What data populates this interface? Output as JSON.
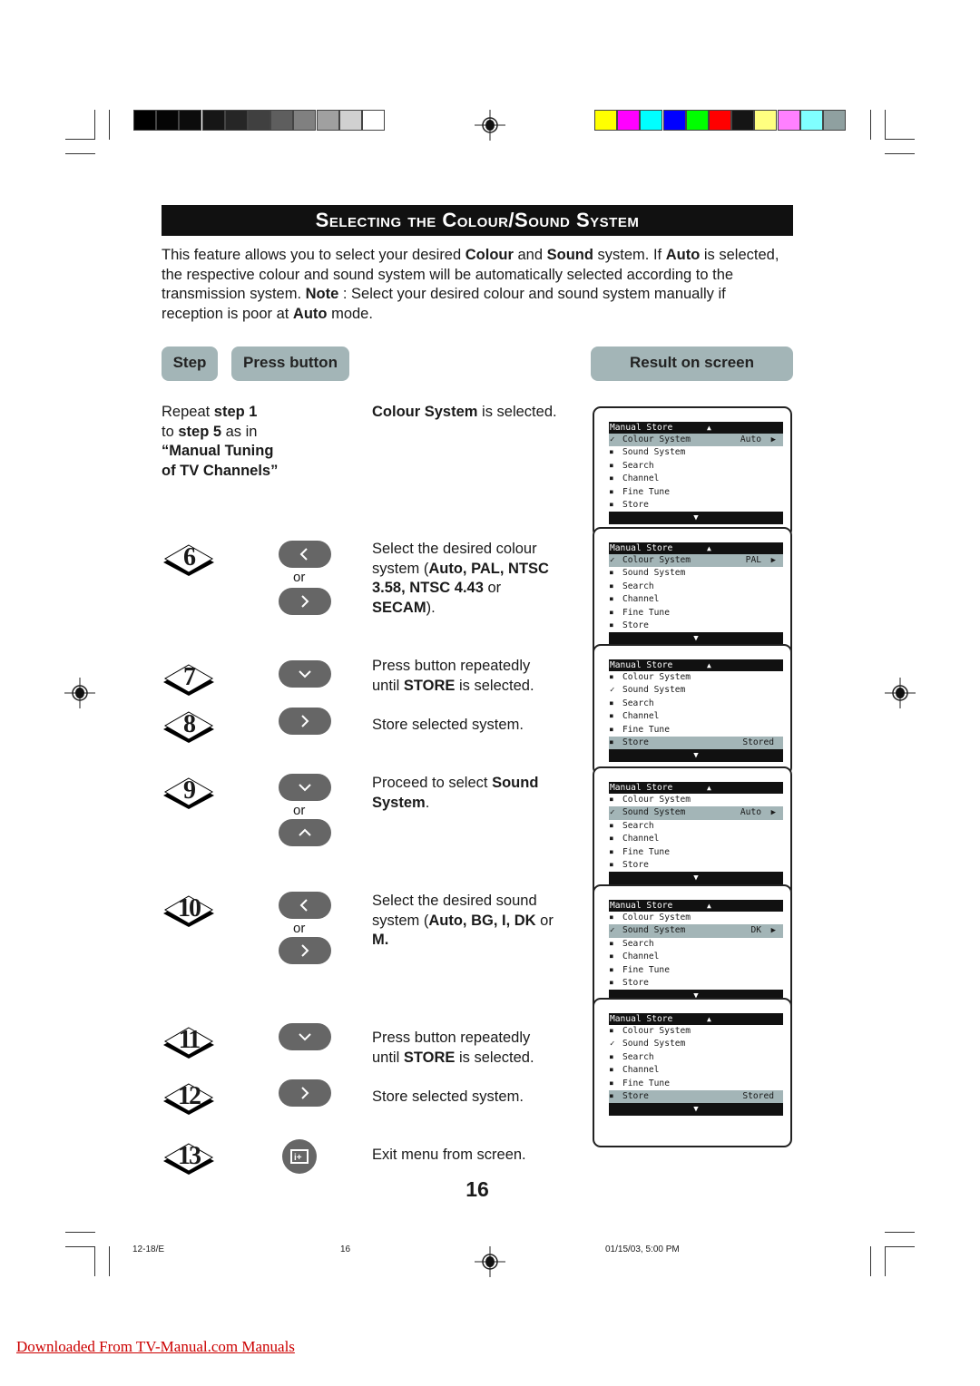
{
  "colors": {
    "gray_scale": [
      "#000000",
      "#050505",
      "#0c0c0c",
      "#161616",
      "#262626",
      "#404040",
      "#5e5e5e",
      "#808080",
      "#a0a0a0",
      "#d0d0d0",
      "#ffffff"
    ],
    "color_bars": [
      "#ffff00",
      "#ff00ff",
      "#00ffff",
      "#0000ff",
      "#00ff00",
      "#ff0000",
      "#151515",
      "#ffff80",
      "#ff80ff",
      "#80ffff",
      "#8fa0a0"
    ],
    "header_fill": "#a3b5b7",
    "button_fill": "#666666"
  },
  "title": "Selecting the Colour/Sound System",
  "intro": {
    "p1": "This feature allows you to select your desired ",
    "b1": "Colour",
    "p2": " and ",
    "b2": "Sound",
    "p3": " system. If ",
    "b3": "Auto",
    "p4": " is selected, the respective colour and sound system will be automatically selected according to the transmission system. ",
    "b4": "Note",
    "p5": " : Select your desired colour and sound system manually if reception is poor at ",
    "b5": "Auto",
    "p6": " mode."
  },
  "headers": {
    "step": "Step",
    "press": "Press button",
    "result": "Result on screen"
  },
  "repeat": {
    "t1": "Repeat ",
    "b1": "step 1",
    "t2": "to ",
    "b2": "step 5",
    "t3": " as in",
    "b3": "“Manual Tuning",
    "b4": "of TV Channels”"
  },
  "colour_selected": {
    "b": "Colour System",
    "t": " is selected."
  },
  "steps": [
    {
      "num": "6",
      "button": "left",
      "alt_button": "right",
      "or": "or",
      "desc": [
        {
          "t": "Select the desired colour system  ("
        },
        {
          "b": "Auto, PAL, NTSC 3.58, NTSC 4.43"
        },
        {
          "t": " or "
        },
        {
          "b": "SECAM"
        },
        {
          "t": ")."
        }
      ]
    },
    {
      "num": "7",
      "button": "down",
      "desc": [
        {
          "t": "Press button repeatedly until "
        },
        {
          "b": "STORE"
        },
        {
          "t": " is selected."
        }
      ]
    },
    {
      "num": "8",
      "button": "right",
      "desc": [
        {
          "t": "Store selected system."
        }
      ]
    },
    {
      "num": "9",
      "button": "down",
      "alt_button": "up",
      "or": "or",
      "desc": [
        {
          "t": "Proceed to select "
        },
        {
          "b": "Sound System"
        },
        {
          "t": "."
        }
      ]
    },
    {
      "num": "10",
      "button": "left",
      "alt_button": "right",
      "or": "or",
      "desc": [
        {
          "t": "Select the desired sound system  ("
        },
        {
          "b": "Auto, BG, I, DK"
        },
        {
          "t": " or "
        },
        {
          "b": "M."
        }
      ]
    },
    {
      "num": "11",
      "button": "down",
      "desc": [
        {
          "t": "Press button repeatedly until "
        },
        {
          "b": "STORE"
        },
        {
          "t": " is selected."
        }
      ]
    },
    {
      "num": "12",
      "button": "right",
      "desc": [
        {
          "t": "Store selected system."
        }
      ]
    },
    {
      "num": "13",
      "button": "osd-info",
      "desc": [
        {
          "t": "Exit menu from screen."
        }
      ]
    }
  ],
  "menus": [
    {
      "title": "Manual Store",
      "checked": 0,
      "selected": 0,
      "value": "Auto",
      "arrow": true
    },
    {
      "title": "Manual Store",
      "checked": 0,
      "selected": 0,
      "value": "PAL",
      "arrow": true
    },
    {
      "title": "Manual Store",
      "checked": 1,
      "selected": 5,
      "value": "Stored",
      "arrow": false
    },
    {
      "title": "Manual Store",
      "checked": 1,
      "selected": 1,
      "value": "Auto",
      "arrow": true
    },
    {
      "title": "Manual Store",
      "checked": 1,
      "selected": 1,
      "value": "DK",
      "arrow": true
    },
    {
      "title": "Manual Store",
      "checked": 1,
      "selected": 5,
      "value": "Stored",
      "arrow": false
    }
  ],
  "menu_items": [
    "Colour System",
    "Sound System",
    "Search",
    "Channel",
    "Fine Tune",
    "Store"
  ],
  "page_number": "16",
  "footer": {
    "left": "12-18/E",
    "center": "16",
    "right": "01/15/03, 5:00 PM"
  },
  "link": "Downloaded From TV-Manual.com Manuals"
}
